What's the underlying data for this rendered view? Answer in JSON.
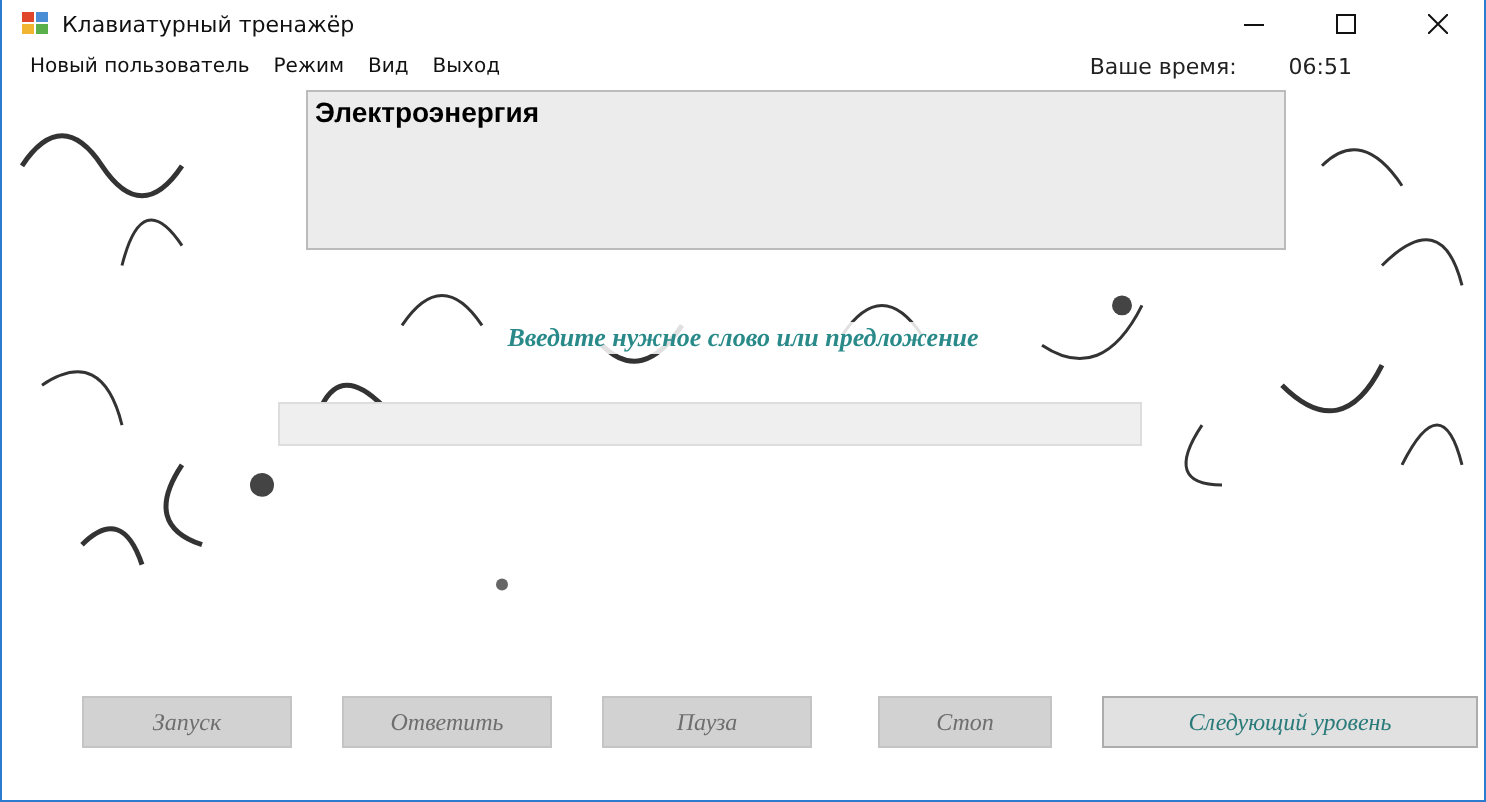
{
  "window": {
    "title": "Клавиатурный тренажёр"
  },
  "menu": [
    "Новый пользователь",
    "Режим",
    "Вид",
    "Выход"
  ],
  "timer": {
    "label": "Ваше время:",
    "value": "06:51"
  },
  "task_text": "Электроэнергия",
  "prompt": "Введите нужное слово или предложение",
  "buttons": [
    {
      "label": "Запуск",
      "disabled": true
    },
    {
      "label": "Ответить",
      "disabled": true
    },
    {
      "label": "Пауза",
      "disabled": true
    },
    {
      "label": "Стоп",
      "disabled": true
    },
    {
      "label": "Следующий уровень",
      "disabled": false
    }
  ]
}
